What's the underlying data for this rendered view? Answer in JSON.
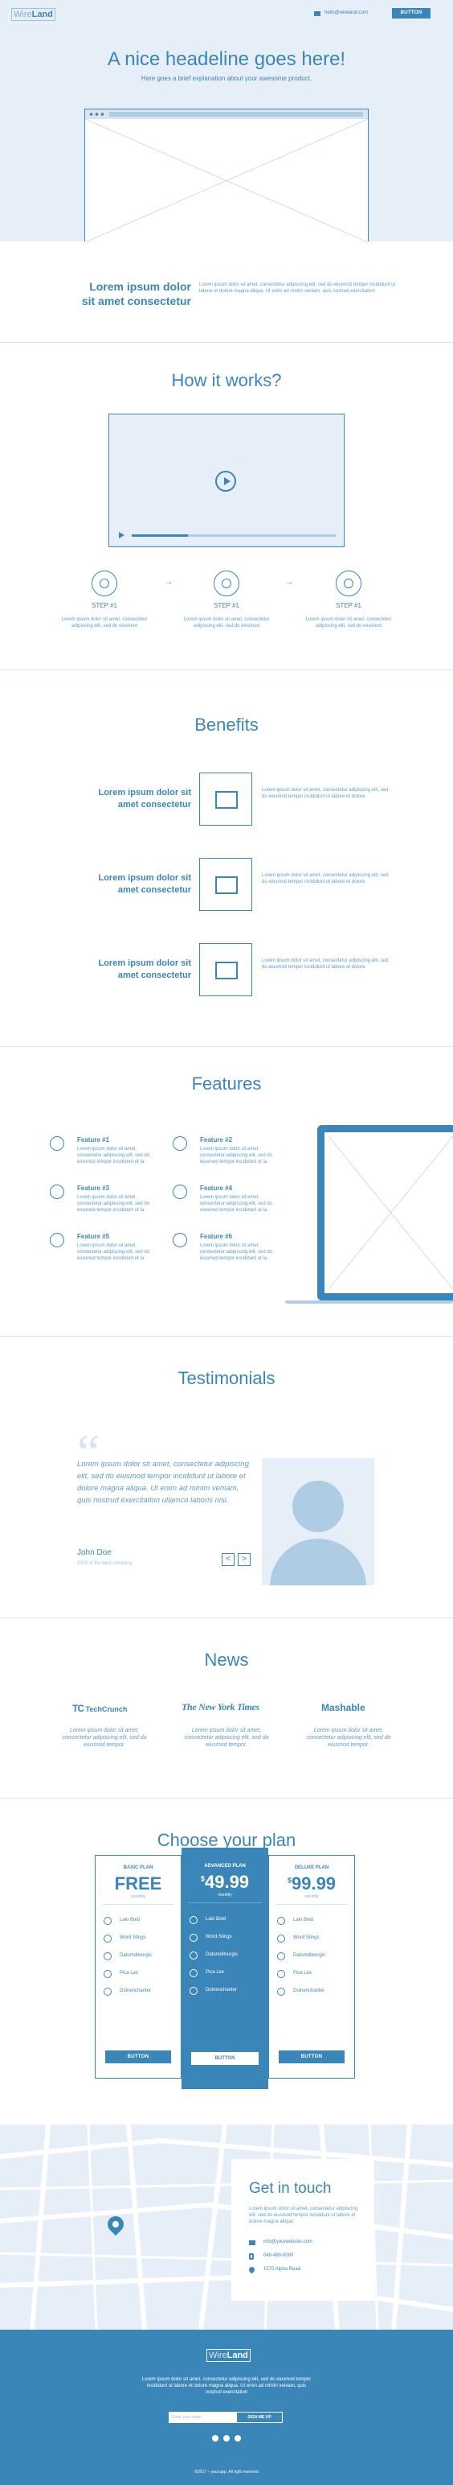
{
  "header": {
    "logo_a": "Wire",
    "logo_b": "Land",
    "email": "hello@wireland.com",
    "button": "BUTTON"
  },
  "hero": {
    "title": "A nice headeline goes here!",
    "subtitle": "Here goes a brief explanation about your awesome product."
  },
  "intro": {
    "title_l1": "Lorem ipsum dolor",
    "title_l2": "sit amet consectetur",
    "text": "Lorem ipsum dolor sit amet, consectetur adipiscing elit, sed do eiusmod tempor incididunt ut labore et dolore magna aliqua. Ut enim ad minim veniam, quis nostrud exercitation"
  },
  "how": {
    "title": "How it works?",
    "steps": [
      {
        "label": "STEP #1",
        "text": "Lorem ipsum dolor sit amet, consectetur adipiscing elit, sed do eiusmod"
      },
      {
        "label": "STEP #1",
        "text": "Lorem ipsum dolor sit amet, consectetur adipiscing elit, sed do eiusmod"
      },
      {
        "label": "STEP #1",
        "text": "Lorem ipsum dolor sit amet, consectetur adipiscing elit, sed do eiusmod"
      }
    ],
    "arrow": "→"
  },
  "benefits": {
    "title": "Benefits",
    "items": [
      {
        "title_l1": "Lorem ipsum dolor sit",
        "title_l2": "amet consectetur",
        "text": "Lorem ipsum dolor sit amet, consectetur adipiscing elit, sed do eiusmod tempor incididunt ut labore et dolore."
      },
      {
        "title_l1": "Lorem ipsum dolor sit",
        "title_l2": "amet consectetur",
        "text": "Lorem ipsum dolor sit amet, consectetur adipiscing elit, sed do eiusmod tempor incididunt ut labore et dolore."
      },
      {
        "title_l1": "Lorem ipsum dolor sit",
        "title_l2": "amet consectetur",
        "text": "Lorem ipsum dolor sit amet, consectetur adipiscing elit, sed do eiusmod tempor incididunt ut labore et dolore."
      }
    ]
  },
  "features": {
    "title": "Features",
    "items": [
      {
        "title": "Feature #1",
        "text": "Lorem ipsum dolor sit amet, consectetur adipiscing elit, sed do eiusmod tempor incididunt ut la."
      },
      {
        "title": "Feature #2",
        "text": "Lorem ipsum dolor sit amet, consectetur adipiscing elit, sed do eiusmod tempor incididunt ut la."
      },
      {
        "title": "Feature #3",
        "text": "Lorem ipsum dolor sit amet, consectetur adipiscing elit, sed do eiusmod tempor incididunt ut la."
      },
      {
        "title": "Feature #4",
        "text": "Lorem ipsum dolor sit amet, consectetur adipiscing elit, sed do eiusmod tempor incididunt ut la."
      },
      {
        "title": "Feature #5",
        "text": "Lorem ipsum dolor sit amet, consectetur adipiscing elit, sed do eiusmod tempor incididunt ut la."
      },
      {
        "title": "Feature #6",
        "text": "Lorem ipsum dolor sit amet, consectetur adipiscing elit, sed do eiusmod tempor incididunt ut la."
      }
    ]
  },
  "testimonials": {
    "title": "Testimonials",
    "quote": "Lorem ipsum dolor sit amet, consectetur adipiscing elit, sed do eiusmod tempor incididunt ut labore et dolore magna aliqua. Ut enim ad minim veniam, quis nostrud exercitation ullamco laboris nisi.",
    "name": "John Doe",
    "role": "CEO of the best company",
    "prev": "<",
    "next": ">"
  },
  "news": {
    "title": "News",
    "logos": [
      "TechCrunch",
      "The New York Times",
      "Mashable"
    ],
    "tc_mark": "TC",
    "texts": [
      "Lorem ipsum dolor sit amet, consectetur adipiscing elit, sed do eiusmod tempor.",
      "Lorem ipsum dolor sit amet, consectetur adipiscing elit, sed do eiusmod tempor.",
      "Lorem ipsum dolor sit amet, consectetur adipiscing elit, sed do eiusmod tempor."
    ]
  },
  "pricing": {
    "title": "Choose your plan",
    "plans": [
      {
        "name": "BASIC PLAN",
        "price": "FREE",
        "currency": "",
        "cents": "",
        "period": "monthly",
        "features": [
          "Lalo Bold",
          "Word Stings",
          "Datumditvurgis",
          "Pica Lex",
          "Dolnenchanter"
        ],
        "button": "BUTTON"
      },
      {
        "name": "ADVANCED PLAN",
        "price": "49",
        "currency": "$",
        "cents": ".99",
        "period": "monthly",
        "features": [
          "Lalo Bold",
          "Word Stings",
          "Datumditvurgis",
          "Pica Lex",
          "Dolnenchanter"
        ],
        "button": "BUTTON"
      },
      {
        "name": "DELUXE PLAN",
        "price": "99",
        "currency": "$",
        "cents": ".99",
        "period": "monthly",
        "features": [
          "Lalo Bold",
          "Word Stings",
          "Datumditvurgis",
          "Pica Lex",
          "Dolnenchanter"
        ],
        "button": "BUTTON"
      }
    ]
  },
  "contact": {
    "title": "Get in touch",
    "text": "Lorem ipsum dolor sit amet, consectetur adipiscing elit, sed do eiusmod tempor incididunt ut labore et dolore magna aliqua.",
    "email": "info@yourwebsite.com",
    "phone": "048-490-0000",
    "address": "1570 Alpha Road"
  },
  "footer": {
    "logo_a": "Wire",
    "logo_b": "Land",
    "text": "Lorem ipsum dolor sit amet, consectetur adipiscing elit, sed do eiusmod tempor incididunt ut labore et dolore magna aliqua. Ut enim ad minim veniam, quis nostrud exercitation",
    "placeholder": "Enter your email",
    "button": "SIGN ME UP",
    "copyright": "©2017 – your.app. All right reserved"
  },
  "colors": {
    "primary": "#3b86b8",
    "pale": "#e6eef7"
  }
}
